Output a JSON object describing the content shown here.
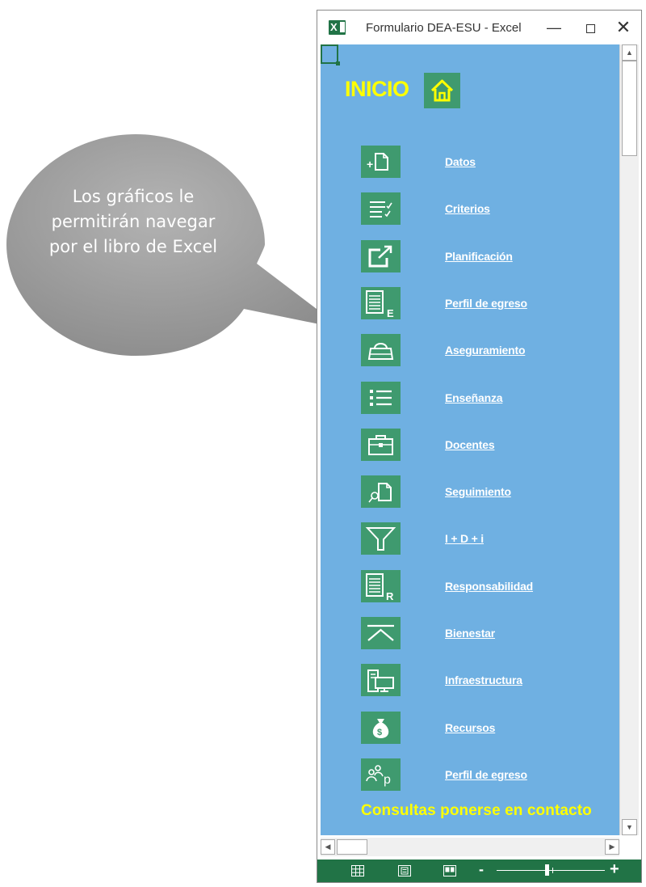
{
  "callout": {
    "text": "Los gráficos le permitirán navegar por el libro de Excel"
  },
  "window": {
    "title": "Formulario DEA-ESU - Excel",
    "app_icon": "excel-icon",
    "minimize_icon": "minimize-icon",
    "maximize_icon": "maximize-icon",
    "close_icon": "close-icon"
  },
  "sheet": {
    "heading": "INICIO",
    "home_icon": "home-icon",
    "colors": {
      "background": "#6fb0e2",
      "tile": "#3f9a6f",
      "heading": "#ffff00",
      "link": "#ffffff"
    },
    "nav_items": [
      {
        "label": "Datos",
        "icon": "new-document-icon"
      },
      {
        "label": "Criterios",
        "icon": "checklist-icon"
      },
      {
        "label": "Planificación",
        "icon": "export-arrow-icon"
      },
      {
        "label": "Perfil de egreso",
        "icon": "document-e-icon"
      },
      {
        "label": "Aseguramiento",
        "icon": "handbag-icon"
      },
      {
        "label": "Enseñanza",
        "icon": "bulleted-list-icon"
      },
      {
        "label": "Docentes",
        "icon": "briefcase-icon"
      },
      {
        "label": "Seguimiento",
        "icon": "search-document-icon"
      },
      {
        "label": "I + D + i",
        "icon": "filter-icon"
      },
      {
        "label": "Responsabilidad",
        "icon": "document-r-icon"
      },
      {
        "label": "Bienestar",
        "icon": "collapse-up-icon"
      },
      {
        "label": "Infraestructura",
        "icon": "computer-icon"
      },
      {
        "label": "Recursos",
        "icon": "money-bag-icon"
      },
      {
        "label": "Perfil de egreso",
        "icon": "people-p-icon"
      }
    ],
    "footer_text": "Consultas ponerse en contacto"
  },
  "statusbar": {
    "view_icons": [
      "normal-view-icon",
      "page-layout-icon",
      "page-break-preview-icon"
    ],
    "zoom_minus": "-",
    "zoom_plus": "+",
    "zoom_level": 0.45
  }
}
